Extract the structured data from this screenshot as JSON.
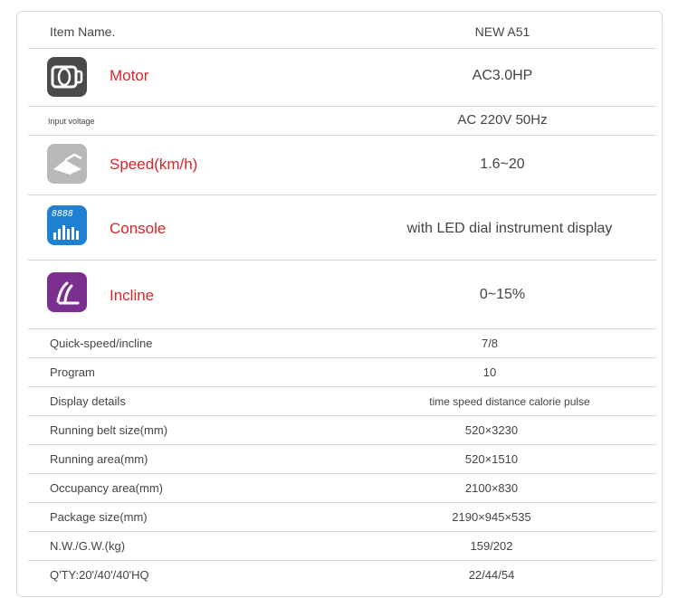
{
  "header": {
    "label": "Item Name.",
    "value": "NEW A51"
  },
  "features": [
    {
      "label": "Motor",
      "value": "AC3.0HP",
      "icon": "motor-icon",
      "color": "#4a4a4a"
    },
    {
      "label": "Speed(km/h)",
      "value": "1.6~20",
      "icon": "speed-icon",
      "color": "#b8b8b8"
    },
    {
      "label": "Console",
      "value": "with LED dial instrument display",
      "icon": "console-icon",
      "color": "#1f7fd1"
    },
    {
      "label": "Incline",
      "value": "0~15%",
      "icon": "incline-icon",
      "color": "#7b2f8e"
    }
  ],
  "input_voltage": {
    "label": "Input voltage",
    "value": "AC 220V 50Hz"
  },
  "console_icon_text": "8888",
  "specs": [
    {
      "label": "Quick-speed/incline",
      "value": "7/8"
    },
    {
      "label": "Program",
      "value": "10"
    },
    {
      "label": "Display details",
      "value": "time speed distance calorie pulse"
    },
    {
      "label": "Running belt size(mm)",
      "value": "520×3230"
    },
    {
      "label": "Running area(mm)",
      "value": "520×1510"
    },
    {
      "label": "Occupancy area(mm)",
      "value": "2100×830"
    },
    {
      "label": "Package size(mm)",
      "value": "2190×945×535"
    },
    {
      "label": "N.W./G.W.(kg)",
      "value": "159/202"
    },
    {
      "label": "Q'TY:20'/40'/40'HQ",
      "value": "22/44/54"
    }
  ]
}
